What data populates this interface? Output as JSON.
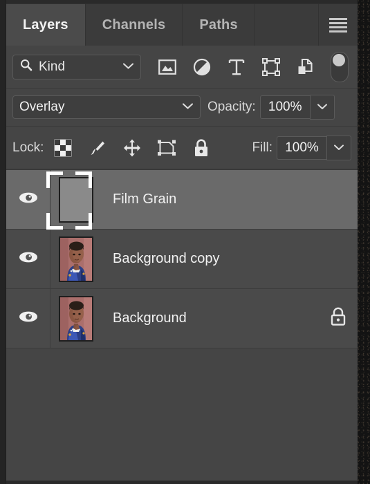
{
  "panel": {
    "tabs": [
      {
        "label": "Layers",
        "active": true
      },
      {
        "label": "Channels",
        "active": false
      },
      {
        "label": "Paths",
        "active": false
      }
    ],
    "menu_icon": "hamburger-menu-icon"
  },
  "filter": {
    "search_icon": "search-icon",
    "kind_label": "Kind",
    "chevron_icon": "chevron-down-icon",
    "type_icons": [
      "pixel-layer-filter-icon",
      "adjustment-layer-filter-icon",
      "type-layer-filter-icon",
      "shape-layer-filter-icon",
      "smart-object-filter-icon"
    ],
    "toggle_icon": "filter-enable-toggle"
  },
  "blend": {
    "mode": "Overlay",
    "mode_chevron_icon": "chevron-down-icon",
    "opacity_caption": "Opacity:",
    "opacity_value": "100%",
    "opacity_stepper_icon": "chevron-down-icon"
  },
  "lock": {
    "caption": "Lock:",
    "icons": [
      "lock-transparent-pixels-icon",
      "lock-image-pixels-icon",
      "lock-position-icon",
      "lock-nesting-artboard-icon",
      "lock-all-icon"
    ],
    "fill_caption": "Fill:",
    "fill_value": "100%",
    "fill_stepper_icon": "chevron-down-icon"
  },
  "layers": [
    {
      "name": "Film Grain",
      "visible": true,
      "selected": true,
      "thumb": "flat-gray",
      "locked": false,
      "eye_icon": "eye-visibility-icon"
    },
    {
      "name": "Background copy",
      "visible": true,
      "selected": false,
      "thumb": "portrait",
      "locked": false,
      "eye_icon": "eye-visibility-icon"
    },
    {
      "name": "Background",
      "visible": true,
      "selected": false,
      "thumb": "portrait",
      "locked": true,
      "lock_icon": "layer-locked-icon",
      "eye_icon": "eye-visibility-icon"
    }
  ],
  "colors": {
    "panel_bg": "#454545",
    "tab_active_bg": "#4b4b4b",
    "tab_inactive_bg": "#3b3b3b",
    "row_bg": "#4a4a4a",
    "row_selected_bg": "#6a6a6a",
    "text": "#f1f1f1",
    "icon": "#d8d8d8"
  }
}
